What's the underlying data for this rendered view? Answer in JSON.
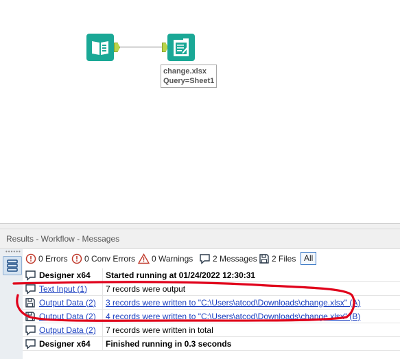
{
  "canvas": {
    "annotation_line1": "change.xlsx",
    "annotation_line2": "Query=Sheet1"
  },
  "results": {
    "title": "Results - Workflow - Messages",
    "grip": "••••••",
    "filters": {
      "errors": "0 Errors",
      "conv_errors": "0 Conv Errors",
      "warnings": "0 Warnings",
      "messages": "2 Messages",
      "files": "2 Files",
      "all": "All"
    },
    "rows": [
      {
        "icon": "message-icon",
        "tool": "Designer x64",
        "tool_link": false,
        "text": "Started running at 01/24/2022 12:30:31",
        "bold": true,
        "text_link": false
      },
      {
        "icon": "message-icon",
        "tool": "Text Input (1)",
        "tool_link": true,
        "text": "7 records were output",
        "bold": false,
        "text_link": false
      },
      {
        "icon": "file-icon",
        "tool": "Output Data (2)",
        "tool_link": true,
        "text": "3 records were written to \"C:\\Users\\atcod\\Downloads\\change.xlsx\" (A)",
        "bold": false,
        "text_link": true
      },
      {
        "icon": "file-icon",
        "tool": "Output Data (2)",
        "tool_link": true,
        "text": "4 records were written to \"C:\\Users\\atcod\\Downloads\\change.xlsx\" (B)",
        "bold": false,
        "text_link": true
      },
      {
        "icon": "message-icon",
        "tool": "Output Data (2)",
        "tool_link": true,
        "text": "7 records were written in total",
        "bold": false,
        "text_link": false
      },
      {
        "icon": "message-icon",
        "tool": "Designer x64",
        "tool_link": false,
        "text": "Finished running in 0.3 seconds",
        "bold": true,
        "text_link": false
      }
    ]
  },
  "colors": {
    "tool_teal": "#1aa896",
    "anchor_green": "#b9d44a",
    "link_blue": "#1a3fc0",
    "annotation_red": "#e0001a"
  }
}
